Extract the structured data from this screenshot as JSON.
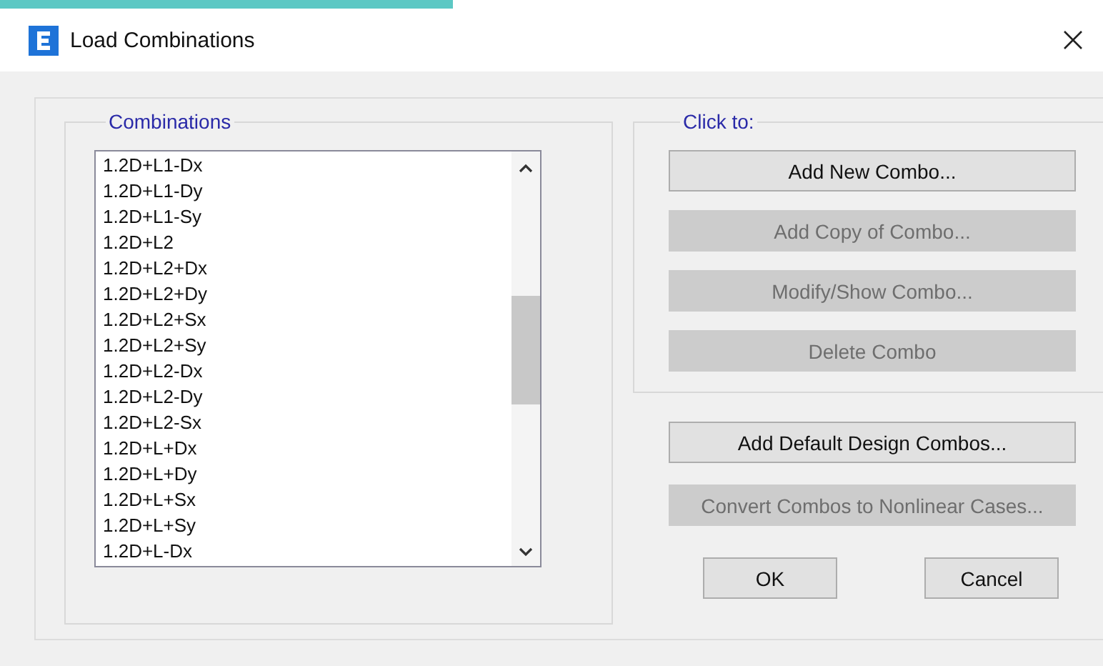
{
  "window": {
    "title": "Load Combinations"
  },
  "combinations": {
    "label": "Combinations",
    "items": [
      "1.2D+L1-Dx",
      "1.2D+L1-Dy",
      "1.2D+L1-Sy",
      "1.2D+L2",
      "1.2D+L2+Dx",
      "1.2D+L2+Dy",
      "1.2D+L2+Sx",
      "1.2D+L2+Sy",
      "1.2D+L2-Dx",
      "1.2D+L2-Dy",
      "1.2D+L2-Sx",
      "1.2D+L+Dx",
      "1.2D+L+Dy",
      "1.2D+L+Sx",
      "1.2D+L+Sy",
      "1.2D+L-Dx"
    ]
  },
  "click_to": {
    "label": "Click to:",
    "buttons": [
      {
        "label": "Add New Combo...",
        "disabled": false
      },
      {
        "label": "Add Copy of Combo...",
        "disabled": true
      },
      {
        "label": "Modify/Show Combo...",
        "disabled": true
      },
      {
        "label": "Delete Combo",
        "disabled": true
      }
    ]
  },
  "extra_buttons": [
    {
      "label": "Add Default Design Combos...",
      "disabled": false
    },
    {
      "label": "Convert Combos to Nonlinear Cases...",
      "disabled": true
    }
  ],
  "dialog_buttons": [
    {
      "label": "OK"
    },
    {
      "label": "Cancel"
    }
  ]
}
